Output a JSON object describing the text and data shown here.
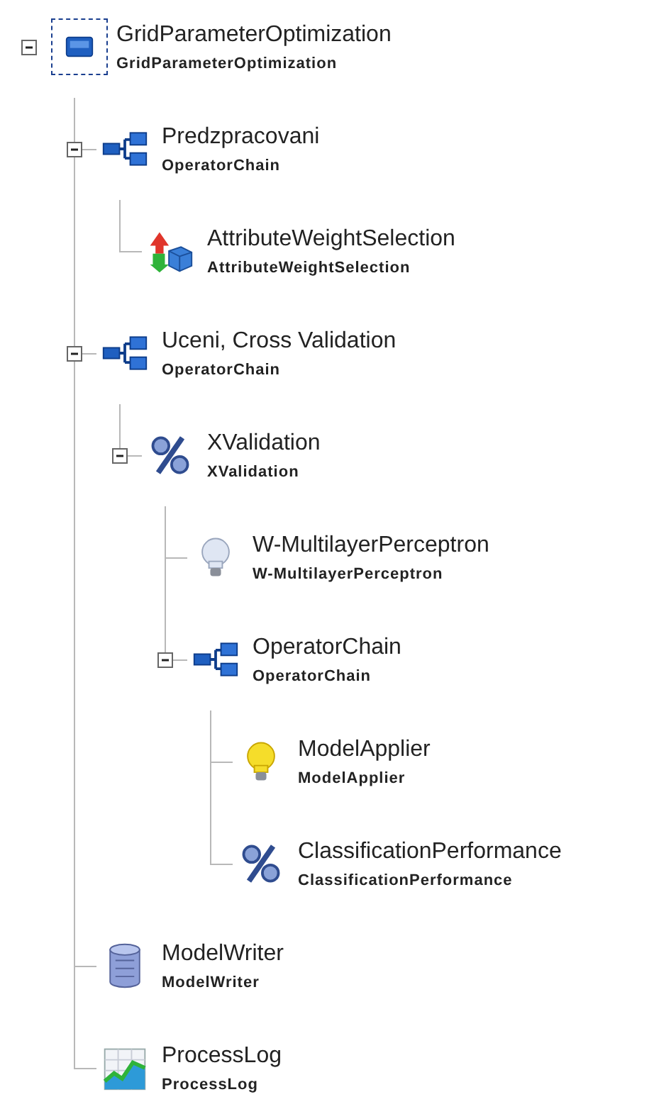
{
  "tree": {
    "name": "GridParameterOptimization",
    "type": "GridParameterOptimization",
    "kind": "optimization",
    "selected": true,
    "expanded": true,
    "children": [
      {
        "name": "Predzpracovani",
        "type": "OperatorChain",
        "kind": "chain",
        "selected": false,
        "expanded": true,
        "children": [
          {
            "name": "AttributeWeightSelection",
            "type": "AttributeWeightSelection",
            "kind": "weighting",
            "selected": false
          }
        ]
      },
      {
        "name": "Uceni, Cross Validation",
        "type": "OperatorChain",
        "kind": "chain",
        "selected": false,
        "expanded": true,
        "children": [
          {
            "name": "XValidation",
            "type": "XValidation",
            "kind": "validation",
            "selected": false,
            "expanded": true,
            "children": [
              {
                "name": "W-MultilayerPerceptron",
                "type": "W-MultilayerPerceptron",
                "kind": "learner",
                "selected": false
              },
              {
                "name": "OperatorChain",
                "type": "OperatorChain",
                "kind": "chain",
                "selected": false,
                "expanded": true,
                "children": [
                  {
                    "name": "ModelApplier",
                    "type": "ModelApplier",
                    "kind": "applier",
                    "selected": false
                  },
                  {
                    "name": "ClassificationPerformance",
                    "type": "ClassificationPerformance",
                    "kind": "validation",
                    "selected": false
                  }
                ]
              }
            ]
          }
        ]
      },
      {
        "name": "ModelWriter",
        "type": "ModelWriter",
        "kind": "writer",
        "selected": false
      },
      {
        "name": "ProcessLog",
        "type": "ProcessLog",
        "kind": "log",
        "selected": false
      }
    ]
  }
}
